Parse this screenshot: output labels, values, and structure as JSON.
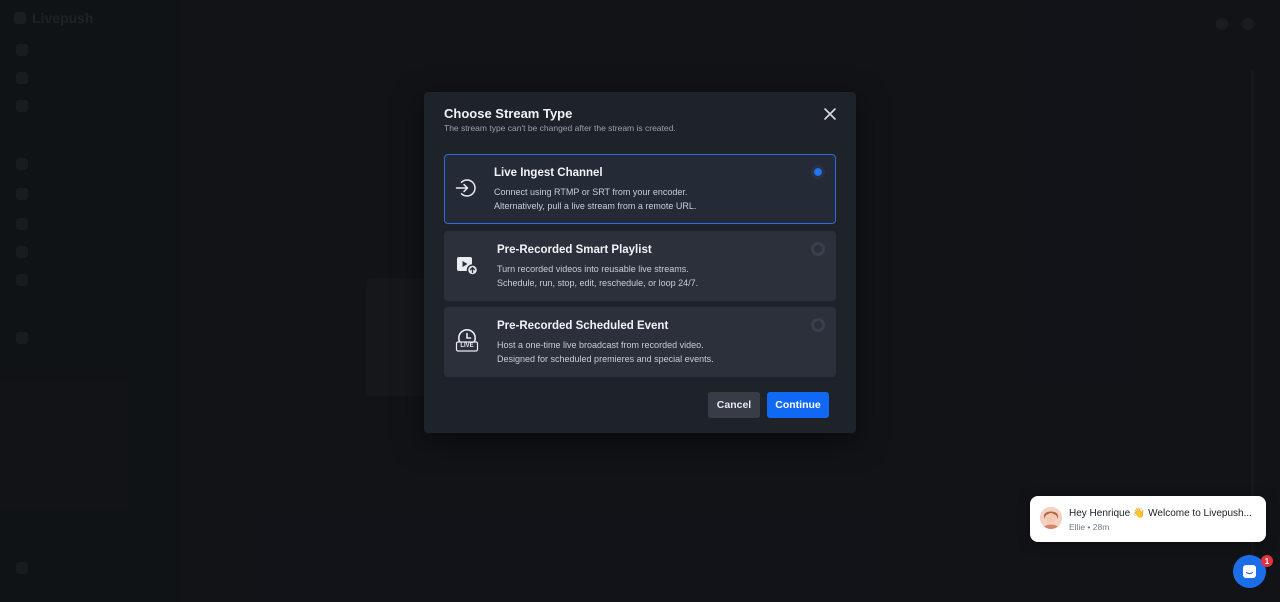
{
  "app": {
    "logo_text": "Livepush"
  },
  "modal": {
    "title": "Choose Stream Type",
    "subtitle": "The stream type can't be changed after the stream is created.",
    "options": [
      {
        "title": "Live Ingest Channel",
        "line1": "Connect using RTMP or SRT from your encoder.",
        "line2": "Alternatively, pull a live stream from a remote URL.",
        "icon": "login-arrow-icon",
        "selected": true
      },
      {
        "title": "Pre-Recorded Smart Playlist",
        "line1": "Turn recorded videos into reusable live streams.",
        "line2": "Schedule, run, stop, edit, reschedule, or loop 24/7.",
        "icon": "video-playlist-icon",
        "selected": false
      },
      {
        "title": "Pre-Recorded Scheduled Event",
        "line1": "Host a one-time live broadcast from recorded video.",
        "line2": "Designed for scheduled premieres and special events.",
        "icon": "live-clock-icon",
        "icon_text": "LIVE",
        "selected": false
      }
    ],
    "cancel_label": "Cancel",
    "continue_label": "Continue"
  },
  "chat": {
    "message": "Hey Henrique 👋 Welcome to Livepush...",
    "meta": "Ellie • 28m",
    "badge_count": "1"
  },
  "colors": {
    "accent": "#1168f5",
    "selected_border": "#2f6bde",
    "modal_bg": "#1e2229",
    "option_bg": "#2b303a",
    "badge": "#e5303e"
  }
}
